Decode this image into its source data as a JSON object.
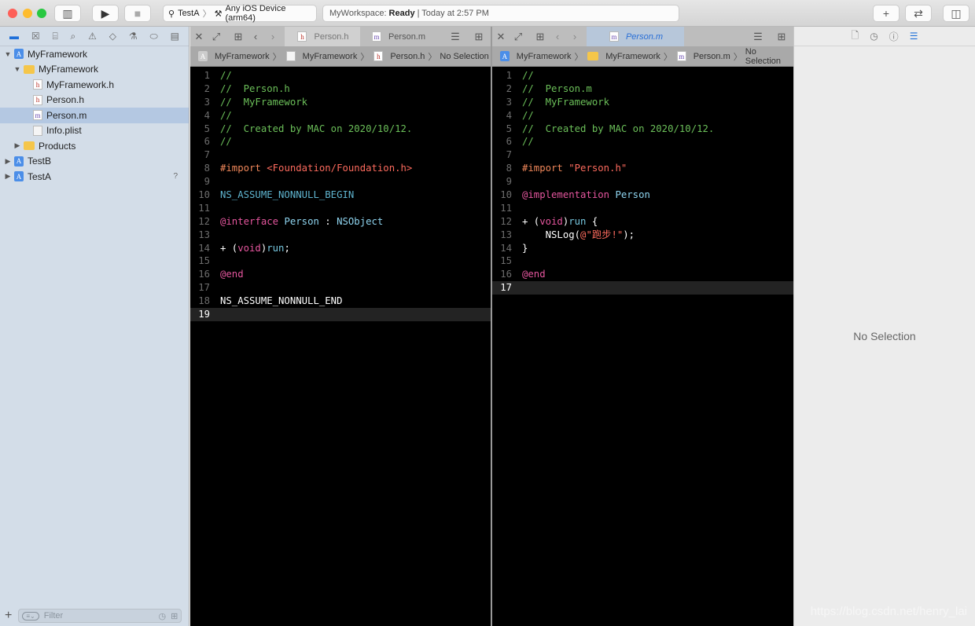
{
  "toolbar": {
    "scheme": "TestA",
    "device": "Any iOS Device (arm64)",
    "status_workspace": "MyWorkspace:",
    "status_state": "Ready",
    "status_time": "| Today at 2:57 PM",
    "colors": {
      "close": "#fe5f57",
      "minimize": "#febc2e",
      "zoom": "#28c840"
    }
  },
  "navigator": {
    "items": [
      {
        "label": "MyFramework",
        "icon": "project-icon",
        "indent": 0,
        "tri": "▼"
      },
      {
        "label": "MyFramework",
        "icon": "folder-icon",
        "indent": 1,
        "tri": "▼"
      },
      {
        "label": "MyFramework.h",
        "icon": "header-file-icon",
        "indent": 2,
        "tri": ""
      },
      {
        "label": "Person.h",
        "icon": "header-file-icon",
        "indent": 2,
        "tri": ""
      },
      {
        "label": "Person.m",
        "icon": "implementation-file-icon",
        "indent": 2,
        "tri": "",
        "selected": true
      },
      {
        "label": "Info.plist",
        "icon": "plist-file-icon",
        "indent": 2,
        "tri": ""
      },
      {
        "label": "Products",
        "icon": "folder-icon",
        "indent": 1,
        "tri": "▶"
      },
      {
        "label": "TestB",
        "icon": "project-icon",
        "indent": 0,
        "tri": "▶"
      },
      {
        "label": "TestA",
        "icon": "project-icon",
        "indent": 0,
        "tri": "▶",
        "badge": "?"
      }
    ],
    "filter_placeholder": "Filter"
  },
  "left_editor": {
    "tabs": [
      {
        "label": "Person.h",
        "active": false
      },
      {
        "label": "Person.m",
        "active": true
      }
    ],
    "jump": [
      "MyFramework",
      "MyFramework",
      "Person.h",
      "No Selection"
    ],
    "current_line": 19,
    "lines": [
      [
        [
          "//",
          "comment"
        ]
      ],
      [
        [
          "//  Person.h",
          "comment"
        ]
      ],
      [
        [
          "//  MyFramework",
          "comment"
        ]
      ],
      [
        [
          "//",
          "comment"
        ]
      ],
      [
        [
          "//  Created by MAC on 2020/10/12.",
          "comment"
        ]
      ],
      [
        [
          "//",
          "comment"
        ]
      ],
      [],
      [
        [
          "#import ",
          "pre"
        ],
        [
          "<Foundation/Foundation.h>",
          "str"
        ]
      ],
      [],
      [
        [
          "NS_ASSUME_NONNULL_BEGIN",
          "macro"
        ]
      ],
      [],
      [
        [
          "@interface",
          "kw"
        ],
        [
          " ",
          "plain"
        ],
        [
          "Person",
          "type"
        ],
        [
          " : ",
          "plain"
        ],
        [
          "NSObject",
          "type"
        ]
      ],
      [],
      [
        [
          "+ (",
          "plain"
        ],
        [
          "void",
          "kw"
        ],
        [
          ")",
          "plain"
        ],
        [
          "run",
          "fn"
        ],
        [
          ";",
          "plain"
        ]
      ],
      [],
      [
        [
          "@end",
          "kw"
        ]
      ],
      [],
      [
        [
          "NS_ASSUME_NONNULL_END",
          "plain"
        ]
      ],
      []
    ]
  },
  "right_editor": {
    "tabs": [
      {
        "label": "Person.m",
        "active": true
      }
    ],
    "jump": [
      "MyFramework",
      "MyFramework",
      "Person.m",
      "No Selection"
    ],
    "current_line": 17,
    "lines": [
      [
        [
          "//",
          "comment"
        ]
      ],
      [
        [
          "//  Person.m",
          "comment"
        ]
      ],
      [
        [
          "//  MyFramework",
          "comment"
        ]
      ],
      [
        [
          "//",
          "comment"
        ]
      ],
      [
        [
          "//  Created by MAC on 2020/10/12.",
          "comment"
        ]
      ],
      [
        [
          "//",
          "comment"
        ]
      ],
      [],
      [
        [
          "#import ",
          "pre"
        ],
        [
          "\"Person.h\"",
          "str"
        ]
      ],
      [],
      [
        [
          "@implementation",
          "kw"
        ],
        [
          " ",
          "plain"
        ],
        [
          "Person",
          "type"
        ]
      ],
      [],
      [
        [
          "+ (",
          "plain"
        ],
        [
          "void",
          "kw"
        ],
        [
          ")",
          "plain"
        ],
        [
          "run",
          "fn"
        ],
        [
          " {",
          "plain"
        ]
      ],
      [
        [
          "    NSLog(",
          "plain"
        ],
        [
          "@\"跑步!\"",
          "str"
        ],
        [
          ");",
          "plain"
        ]
      ],
      [
        [
          "}",
          "plain"
        ]
      ],
      [],
      [
        [
          "@end",
          "kw"
        ]
      ],
      []
    ]
  },
  "inspector": {
    "empty_text": "No Selection"
  },
  "watermark": "https://blog.csdn.net/henry_lai"
}
